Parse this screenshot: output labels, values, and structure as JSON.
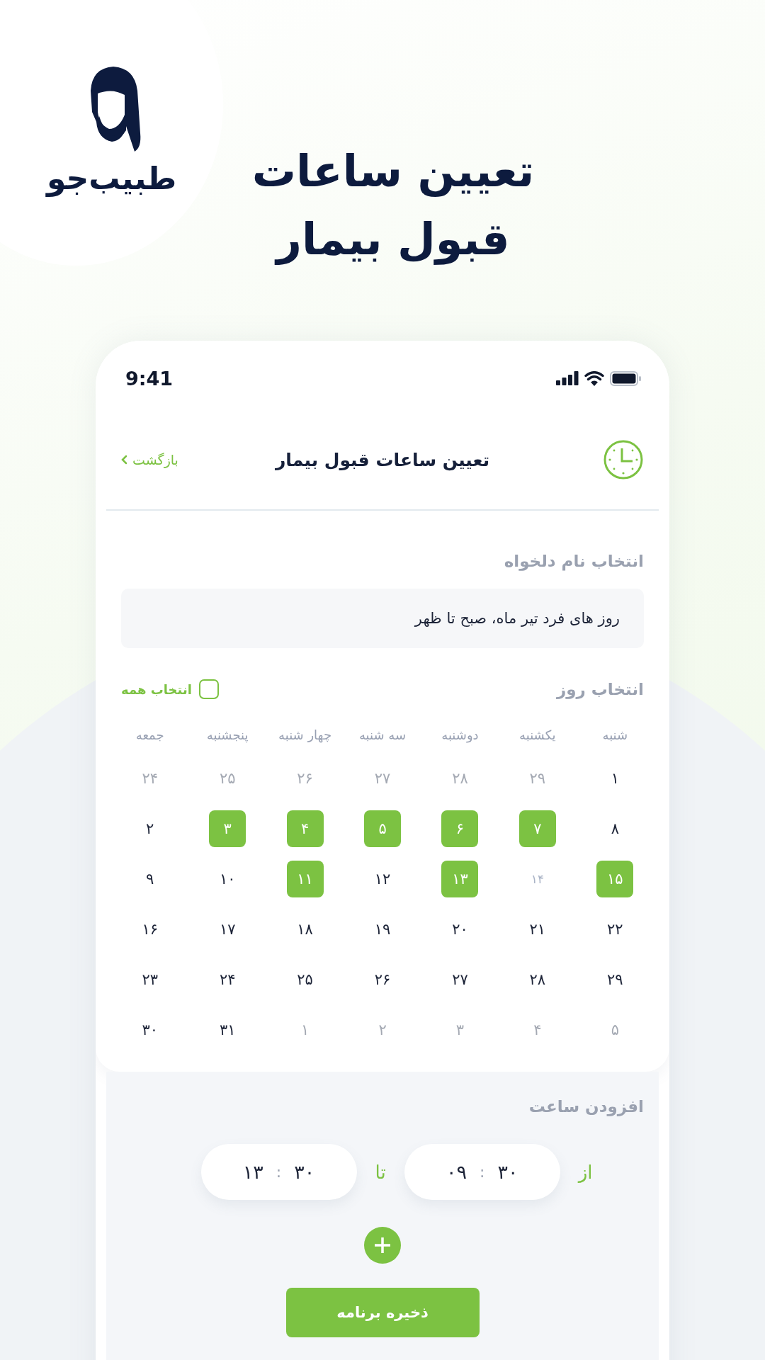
{
  "logo": {
    "name": "طبیب‌جو"
  },
  "headline": [
    "تعیین ساعات",
    "قبول بیمار"
  ],
  "status_bar": {
    "time": "9:41"
  },
  "header": {
    "title": "تعیین ساعات قبول بیمار",
    "back": "بازگشت"
  },
  "name_section": {
    "label": "انتخاب نام دلخواه",
    "value": "روز های فرد تیر ماه، صبح تا ظهر"
  },
  "day_section": {
    "label": "انتخاب روز",
    "select_all": {
      "label": "انتخاب همه",
      "checked": false
    }
  },
  "calendar": {
    "weekdays": [
      "شنبه",
      "یکشنبه",
      "دوشنبه",
      "سه شنبه",
      "چهار شنبه",
      "پنجشنبه",
      "جمعه"
    ],
    "weeks": [
      [
        {
          "day": "۱",
          "kind": "normal",
          "selected": false
        },
        {
          "day": "۲۹",
          "kind": "outside",
          "selected": false
        },
        {
          "day": "۲۸",
          "kind": "outside",
          "selected": false
        },
        {
          "day": "۲۷",
          "kind": "outside",
          "selected": false
        },
        {
          "day": "۲۶",
          "kind": "outside",
          "selected": false
        },
        {
          "day": "۲۵",
          "kind": "outside",
          "selected": false
        },
        {
          "day": "۲۴",
          "kind": "outside",
          "selected": false
        }
      ],
      [
        {
          "day": "۸",
          "kind": "normal",
          "selected": false
        },
        {
          "day": "۷",
          "kind": "normal",
          "selected": true
        },
        {
          "day": "۶",
          "kind": "normal",
          "selected": true
        },
        {
          "day": "۵",
          "kind": "normal",
          "selected": true
        },
        {
          "day": "۴",
          "kind": "normal",
          "selected": true
        },
        {
          "day": "۳",
          "kind": "normal",
          "selected": true
        },
        {
          "day": "۲",
          "kind": "normal",
          "selected": false
        }
      ],
      [
        {
          "day": "۱۵",
          "kind": "normal",
          "selected": true
        },
        {
          "day": "۱۴",
          "kind": "unavailable",
          "selected": false
        },
        {
          "day": "۱۳",
          "kind": "normal",
          "selected": true
        },
        {
          "day": "۱۲",
          "kind": "normal",
          "selected": false
        },
        {
          "day": "۱۱",
          "kind": "normal",
          "selected": true
        },
        {
          "day": "۱۰",
          "kind": "normal",
          "selected": false
        },
        {
          "day": "۹",
          "kind": "normal",
          "selected": false
        }
      ],
      [
        {
          "day": "۲۲",
          "kind": "normal",
          "selected": false
        },
        {
          "day": "۲۱",
          "kind": "normal",
          "selected": false
        },
        {
          "day": "۲۰",
          "kind": "normal",
          "selected": false
        },
        {
          "day": "۱۹",
          "kind": "normal",
          "selected": false
        },
        {
          "day": "۱۸",
          "kind": "normal",
          "selected": false
        },
        {
          "day": "۱۷",
          "kind": "normal",
          "selected": false
        },
        {
          "day": "۱۶",
          "kind": "normal",
          "selected": false
        }
      ],
      [
        {
          "day": "۲۹",
          "kind": "normal",
          "selected": false
        },
        {
          "day": "۲۸",
          "kind": "normal",
          "selected": false
        },
        {
          "day": "۲۷",
          "kind": "normal",
          "selected": false
        },
        {
          "day": "۲۶",
          "kind": "normal",
          "selected": false
        },
        {
          "day": "۲۵",
          "kind": "normal",
          "selected": false
        },
        {
          "day": "۲۴",
          "kind": "normal",
          "selected": false
        },
        {
          "day": "۲۳",
          "kind": "normal",
          "selected": false
        }
      ],
      [
        {
          "day": "۵",
          "kind": "outside",
          "selected": false
        },
        {
          "day": "۴",
          "kind": "outside",
          "selected": false
        },
        {
          "day": "۳",
          "kind": "outside",
          "selected": false
        },
        {
          "day": "۲",
          "kind": "outside",
          "selected": false
        },
        {
          "day": "۱",
          "kind": "outside",
          "selected": false
        },
        {
          "day": "۳۱",
          "kind": "normal",
          "selected": false
        },
        {
          "day": "۳۰",
          "kind": "normal",
          "selected": false
        }
      ]
    ]
  },
  "time_section": {
    "label": "افزودن ساعت",
    "from_label": "از",
    "to_label": "تا",
    "from": {
      "hour": "۰۹",
      "separator": ":",
      "minute": "۳۰"
    },
    "to": {
      "hour": "۱۳",
      "separator": ":",
      "minute": "۳۰"
    }
  },
  "save_button": "ذخیره برنامه"
}
